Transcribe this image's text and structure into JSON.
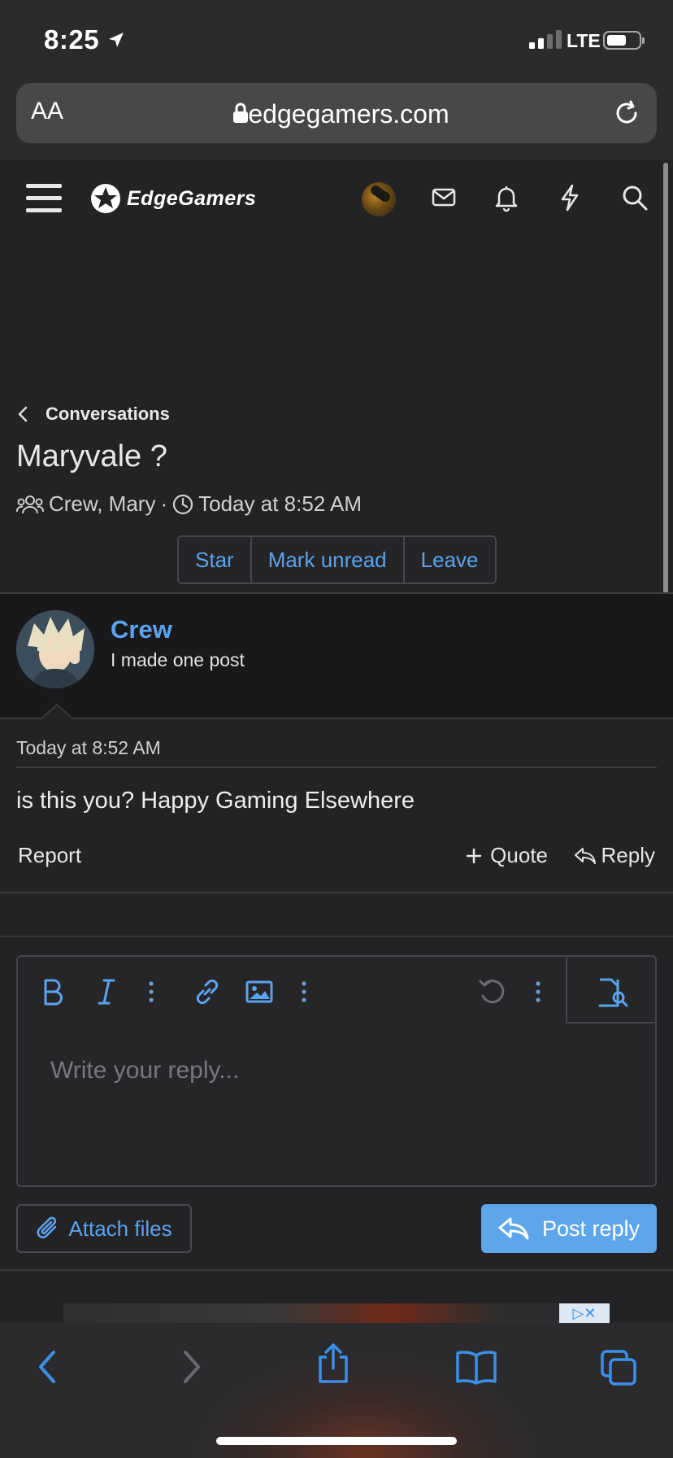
{
  "status_bar": {
    "time": "8:25",
    "network": "LTE"
  },
  "browser": {
    "text_size_label": "AA",
    "url": "edgegamers.com"
  },
  "site": {
    "logo_text": "EdgeGamers"
  },
  "conversation": {
    "breadcrumb": "Conversations",
    "title": "Maryvale ?",
    "participants": "Crew, Mary",
    "meta_sep": "·",
    "date": "Today at 8:52 AM",
    "actions": [
      "Star",
      "Mark unread",
      "Leave"
    ]
  },
  "message": {
    "username": "Crew",
    "user_title": "I made one post",
    "date": "Today at 8:52 AM",
    "body": "is this you? Happy Gaming Elsewhere",
    "report_label": "Report",
    "quote_label": "Quote",
    "reply_label": "Reply"
  },
  "editor": {
    "placeholder": "Write your reply...",
    "attach_label": "Attach files",
    "post_label": "Post reply"
  },
  "ad": {
    "marker": "▷✕"
  },
  "colors": {
    "accent": "#5aa3ee",
    "button": "#5ea6ea",
    "background": "#232325"
  }
}
